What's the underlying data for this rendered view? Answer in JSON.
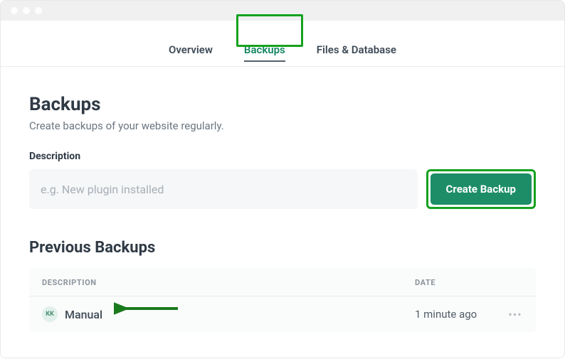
{
  "tabs": {
    "overview": "Overview",
    "backups": "Backups",
    "files_database": "Files & Database"
  },
  "page": {
    "title": "Backups",
    "subtitle": "Create backups of your website regularly."
  },
  "form": {
    "description_label": "Description",
    "description_placeholder": "e.g. New plugin installed",
    "create_button": "Create Backup"
  },
  "previous": {
    "title": "Previous Backups",
    "columns": {
      "description": "DESCRIPTION",
      "date": "DATE"
    },
    "rows": [
      {
        "avatar": "KK",
        "description": "Manual",
        "date": "1 minute ago"
      }
    ]
  }
}
